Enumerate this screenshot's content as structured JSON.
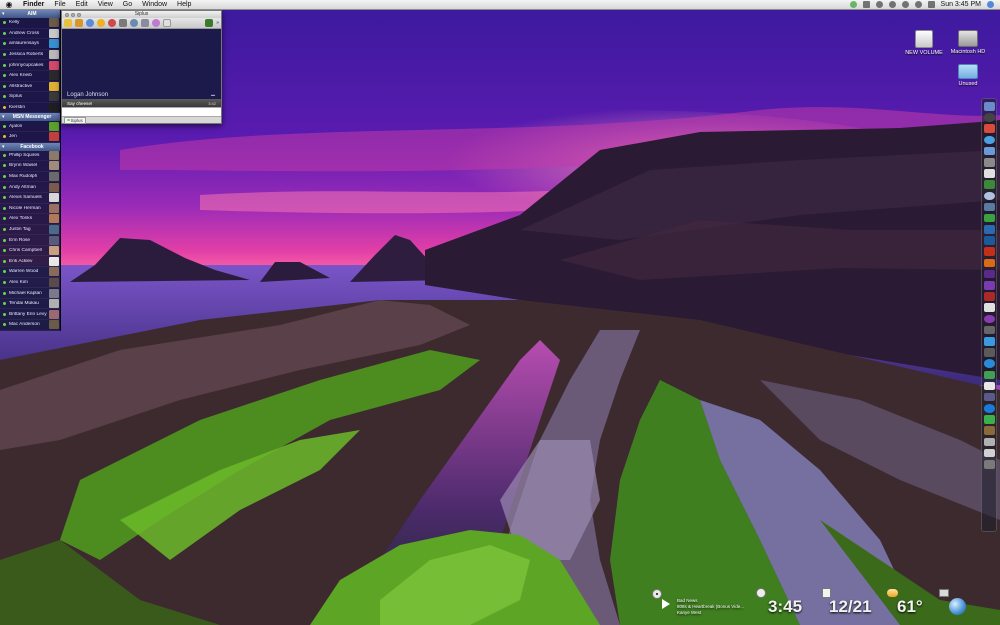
{
  "menubar": {
    "apple": "",
    "app_name": "Finder",
    "menus": [
      "File",
      "Edit",
      "View",
      "Go",
      "Window",
      "Help"
    ],
    "clock": "Sun 3:45 PM"
  },
  "buddylist": {
    "groups": [
      {
        "name": "AIM",
        "buddies": [
          "Kelly",
          "Andrew Cross",
          "amlaurensays",
          "Jessica Roberts",
          "johnnycupcakes",
          "Alex Kneib",
          "Allstractive",
          "Siplus",
          "Kierstin"
        ]
      },
      {
        "name": "MSN Messenger",
        "buddies": [
          "Ajalon",
          "Jen"
        ]
      },
      {
        "name": "Facebook",
        "buddies": [
          "Phillip Squires",
          "Brynn Waisel",
          "Max Rudolph",
          "Andy Altman",
          "Alexis Samuels",
          "Nicole Herman",
          "Alex Tonks",
          "Justin Tag",
          "Erin Rose",
          "Chris Campbell",
          "Erik Acklev",
          "Warren Wood",
          "Alex Kim",
          "Michael Kaplan",
          "Tendai Mukau",
          "Brittany Erin Levy",
          "Mac Anderson"
        ]
      }
    ]
  },
  "chat": {
    "title": "Siplus",
    "contact_name": "Logan Johnson",
    "message": "Say cheese!",
    "message_time": "3:42",
    "tab_label": "Siplus"
  },
  "desktop": {
    "icons": [
      {
        "label": "NEW VOLUME"
      },
      {
        "label": "Macintosh HD"
      },
      {
        "label": "Unused"
      }
    ]
  },
  "widgets": {
    "music": {
      "track": "Bad News",
      "album": "808s & Heartbreak (Bonus Vide...",
      "artist": "Kanye West"
    },
    "clock": "3:45",
    "date": "12/21",
    "temperature": "61°"
  },
  "colors": {
    "sky_top": "#4a1aa8",
    "sky_glow": "#ff4fa8",
    "moss": "#5fae22",
    "sidebar_bg": "#16163a"
  }
}
